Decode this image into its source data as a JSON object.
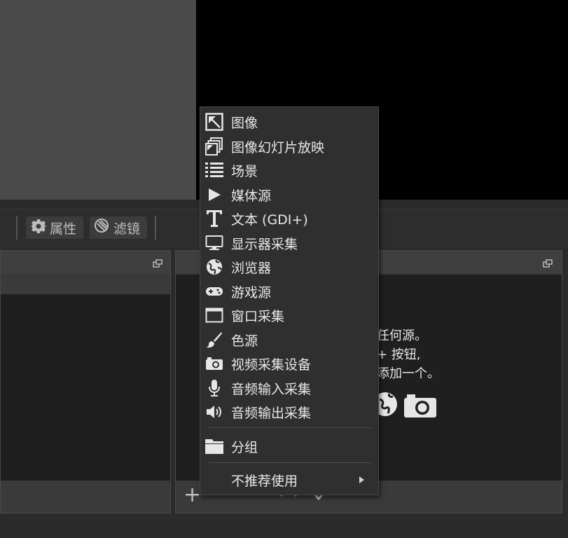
{
  "toolbar": {
    "properties_label": "属性",
    "filters_label": "滤镜"
  },
  "sources_dock": {
    "hint_lines": [
      "任何源。",
      "+ 按钮,",
      "添加一个。"
    ]
  },
  "context_menu": {
    "items": [
      {
        "label": "图像",
        "icon": "image-icon"
      },
      {
        "label": "图像幻灯片放映",
        "icon": "slideshow-icon"
      },
      {
        "label": "场景",
        "icon": "scene-list-icon"
      },
      {
        "label": "媒体源",
        "icon": "play-icon"
      },
      {
        "label": "文本 (GDI+)",
        "icon": "text-icon"
      },
      {
        "label": "显示器采集",
        "icon": "monitor-icon"
      },
      {
        "label": "浏览器",
        "icon": "globe-icon"
      },
      {
        "label": "游戏源",
        "icon": "gamepad-icon"
      },
      {
        "label": "窗口采集",
        "icon": "window-icon"
      },
      {
        "label": "色源",
        "icon": "brush-icon"
      },
      {
        "label": "视频采集设备",
        "icon": "camera-icon"
      },
      {
        "label": "音频输入采集",
        "icon": "microphone-icon"
      },
      {
        "label": "音频输出采集",
        "icon": "speaker-icon"
      }
    ],
    "group_label": "分组",
    "deprecated_label": "不推荐使用"
  }
}
